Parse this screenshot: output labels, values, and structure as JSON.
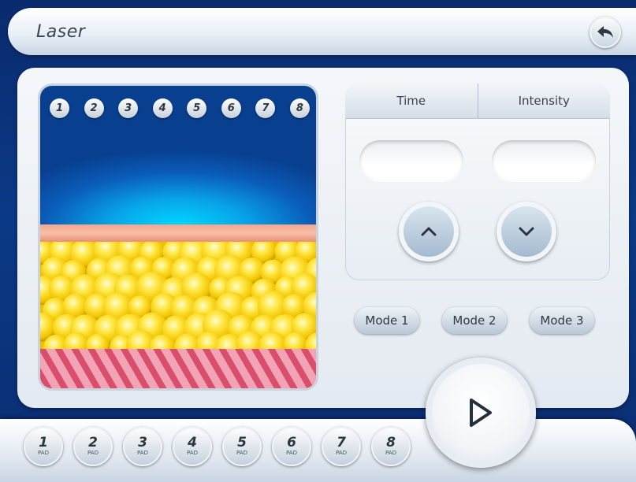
{
  "header": {
    "title": "Laser"
  },
  "scene": {
    "zones": [
      "1",
      "2",
      "3",
      "4",
      "5",
      "6",
      "7",
      "8"
    ]
  },
  "control": {
    "tabs": [
      "Time",
      "Intensity"
    ],
    "time_value": "",
    "intensity_value": ""
  },
  "modes": [
    "Mode 1",
    "Mode 2",
    "Mode 3"
  ],
  "pads": [
    {
      "num": "1",
      "label": "PAD"
    },
    {
      "num": "2",
      "label": "PAD"
    },
    {
      "num": "3",
      "label": "PAD"
    },
    {
      "num": "4",
      "label": "PAD"
    },
    {
      "num": "5",
      "label": "PAD"
    },
    {
      "num": "6",
      "label": "PAD"
    },
    {
      "num": "7",
      "label": "PAD"
    },
    {
      "num": "8",
      "label": "PAD"
    }
  ],
  "colors": {
    "background": "#0b3a86",
    "accent": "#2e3640"
  },
  "icons": [
    "back-arrow-icon",
    "chevron-up-icon",
    "chevron-down-icon",
    "play-icon"
  ]
}
